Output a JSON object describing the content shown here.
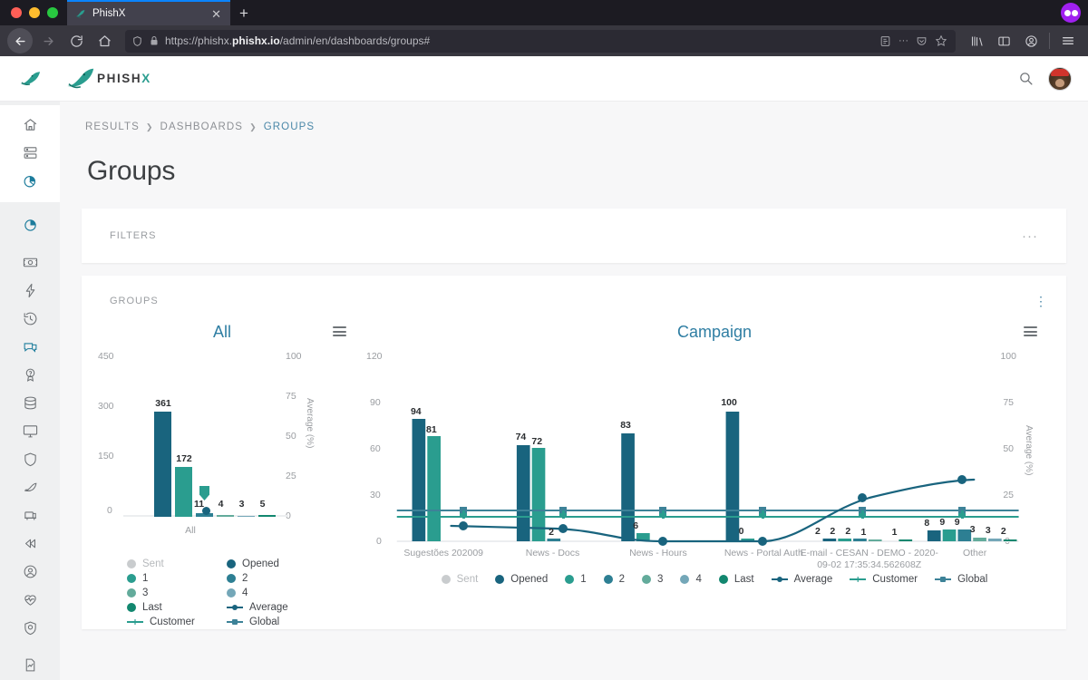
{
  "browser": {
    "tab_title": "PhishX",
    "tab_close": "✕",
    "new_tab": "+",
    "url_display_prefix": "https://phishx.",
    "url_display_bold": "phishx.io",
    "url_display_suffix": "/admin/en/dashboards/groups#",
    "icons": {
      "back": "back-arrow-icon",
      "forward": "forward-arrow-icon",
      "reload": "reload-icon",
      "home": "home-icon",
      "shield": "shield-icon",
      "lock": "lock-icon",
      "reader": "reader-view-icon",
      "ellipsis": "ellipsis-icon",
      "pocket": "pocket-icon",
      "bookmark": "star-bookmark-icon",
      "library": "library-icon",
      "sidebar": "sidebar-icon",
      "account": "account-icon",
      "menu": "hamburger-menu-icon"
    }
  },
  "app": {
    "brand": "PHISH",
    "brand_accent": "X",
    "accent_color": "#2a9d8f",
    "link_color": "#4a87a8",
    "search_icon": "search-icon",
    "avatar": "user-avatar"
  },
  "sidebar": {
    "top_items": [
      {
        "name": "home",
        "label": "Home"
      },
      {
        "name": "server",
        "label": "Infrastructure"
      },
      {
        "name": "pie-chart-active",
        "label": "Dashboards"
      }
    ],
    "items": [
      {
        "name": "pie-chart",
        "label": "Reports"
      },
      {
        "name": "image-frame",
        "label": "Media"
      },
      {
        "name": "bolt",
        "label": "Automation"
      },
      {
        "name": "history",
        "label": "History"
      },
      {
        "name": "chat-bubble",
        "label": "Messages"
      },
      {
        "name": "question-badge",
        "label": "Quiz"
      },
      {
        "name": "database",
        "label": "Database"
      },
      {
        "name": "monitor",
        "label": "Training"
      },
      {
        "name": "shield-outline",
        "label": "Protection"
      },
      {
        "name": "fish-hook",
        "label": "Phishing"
      },
      {
        "name": "presentation",
        "label": "Campaigns"
      },
      {
        "name": "rewind",
        "label": "Replay"
      },
      {
        "name": "user-circle",
        "label": "Users"
      },
      {
        "name": "heart-pulse",
        "label": "Health"
      },
      {
        "name": "shield-check",
        "label": "Security"
      },
      {
        "name": "document",
        "label": "Documents"
      }
    ]
  },
  "breadcrumb": {
    "items": [
      "RESULTS",
      "DASHBOARDS",
      "GROUPS"
    ],
    "separator": "❯"
  },
  "page": {
    "title": "Groups"
  },
  "filters_card": {
    "label": "FILTERS",
    "menu": "···"
  },
  "groups_card": {
    "label": "GROUPS",
    "menu": "⋮"
  },
  "legend_colors": {
    "sent": "#c9ccce",
    "opened": "#19647e",
    "c1": "#2a9d8f",
    "c2": "#2d7f93",
    "c3": "#63ab9b",
    "c4": "#74a7b8",
    "last": "#12876f",
    "average": "#19647e",
    "customer": "#2a9d8f",
    "global": "#3d8298"
  },
  "legend_entries": [
    {
      "label": "Sent",
      "kind": "dot",
      "color": "#c9ccce",
      "muted": true
    },
    {
      "label": "Opened",
      "kind": "dot",
      "color": "#19647e",
      "muted": false
    },
    {
      "label": "1",
      "kind": "dot",
      "color": "#2a9d8f",
      "muted": false
    },
    {
      "label": "2",
      "kind": "dot",
      "color": "#2d7f93",
      "muted": false
    },
    {
      "label": "3",
      "kind": "dot",
      "color": "#63ab9b",
      "muted": false
    },
    {
      "label": "4",
      "kind": "dot",
      "color": "#74a7b8",
      "muted": false
    },
    {
      "label": "Last",
      "kind": "dot",
      "color": "#12876f",
      "muted": false
    },
    {
      "label": "Average",
      "kind": "line-dot",
      "color": "#19647e",
      "muted": false
    },
    {
      "label": "Customer",
      "kind": "line-cross",
      "color": "#2a9d8f",
      "muted": false
    },
    {
      "label": "Global",
      "kind": "line-sq",
      "color": "#3d8298",
      "muted": false
    }
  ],
  "chart_data": [
    {
      "id": "all",
      "type": "bar",
      "title": "All",
      "categories": [
        "All"
      ],
      "xlabel": "",
      "ylabel": "",
      "ylim": [
        0,
        450
      ],
      "yticks": [
        0,
        150,
        300,
        450
      ],
      "y2label": "Average (%)",
      "y2lim": [
        0,
        100
      ],
      "y2ticks": [
        0,
        25,
        50,
        75,
        100
      ],
      "grid": false,
      "legend_position": "bottom",
      "series": [
        {
          "name": "Sent",
          "color": "#c9ccce",
          "values": [
            0
          ]
        },
        {
          "name": "Opened",
          "color": "#19647e",
          "values": [
            361
          ]
        },
        {
          "name": "1",
          "color": "#2a9d8f",
          "values": [
            172
          ]
        },
        {
          "name": "2",
          "color": "#2d7f93",
          "values": [
            11
          ]
        },
        {
          "name": "3",
          "color": "#63ab9b",
          "values": [
            4
          ]
        },
        {
          "name": "4",
          "color": "#74a7b8",
          "values": [
            3
          ]
        },
        {
          "name": "Last",
          "color": "#12876f",
          "values": [
            5
          ]
        }
      ],
      "bar_labels": [
        "361",
        "172",
        "11",
        "4",
        "3",
        "5"
      ],
      "avg_marker_percent": 4.0
    },
    {
      "id": "campaign",
      "type": "bar",
      "title": "Campaign",
      "categories": [
        "Sugestões 202009",
        "News - Docs",
        "News - Hours",
        "News - Portal Auth",
        "E-mail - CESAN - DEMO - 2020-09-02 17:35:34.562608Z",
        "Other"
      ],
      "xlabel": "",
      "ylabel": "",
      "ylim": [
        0,
        120
      ],
      "yticks": [
        0,
        30,
        60,
        90,
        120
      ],
      "y2label": "Average (%)",
      "y2lim": [
        0,
        100
      ],
      "y2ticks": [
        0,
        25,
        50,
        75,
        100
      ],
      "grid": false,
      "legend_position": "bottom",
      "series": [
        {
          "name": "Opened",
          "color": "#19647e",
          "values": [
            94,
            74,
            83,
            100,
            2,
            8
          ]
        },
        {
          "name": "1",
          "color": "#2a9d8f",
          "values": [
            81,
            72,
            6,
            0,
            2,
            9
          ]
        },
        {
          "name": "2",
          "color": "#2d7f93",
          "values": [
            0,
            2,
            0,
            0,
            2,
            9
          ]
        },
        {
          "name": "3",
          "color": "#63ab9b",
          "values": [
            0,
            0,
            0,
            0,
            1,
            3
          ]
        },
        {
          "name": "4",
          "color": "#74a7b8",
          "values": [
            0,
            0,
            0,
            0,
            0,
            3
          ]
        },
        {
          "name": "Last",
          "color": "#12876f",
          "values": [
            0,
            0,
            0,
            0,
            1,
            2
          ]
        }
      ],
      "lines": [
        {
          "name": "Average",
          "color": "#19647e",
          "axis": "right",
          "values": [
            10,
            9,
            0,
            0,
            28,
            38
          ]
        },
        {
          "name": "Customer",
          "color": "#2a9d8f",
          "axis": "right",
          "values": [
            16,
            16,
            16,
            16,
            16,
            16
          ]
        },
        {
          "name": "Global",
          "color": "#3d8298",
          "axis": "right",
          "values": [
            20,
            20,
            20,
            20,
            20,
            20
          ]
        }
      ]
    }
  ]
}
